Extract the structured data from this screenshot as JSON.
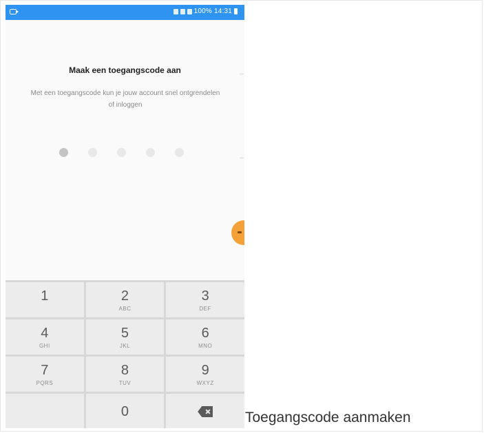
{
  "status_bar": {
    "right_text": "100% 14:31"
  },
  "screen": {
    "title": "Maak een toegangscode aan",
    "subtitle": "Met een toegangscode kun je jouw account snel ontgrendelen of inloggen",
    "pin_dots_total": 5,
    "pin_dots_filled": 1
  },
  "keypad": {
    "keys": [
      {
        "digit": "1",
        "letters": ""
      },
      {
        "digit": "2",
        "letters": "ABC"
      },
      {
        "digit": "3",
        "letters": "DEF"
      },
      {
        "digit": "4",
        "letters": "GHI"
      },
      {
        "digit": "5",
        "letters": "JKL"
      },
      {
        "digit": "6",
        "letters": "MNO"
      },
      {
        "digit": "7",
        "letters": "PQRS"
      },
      {
        "digit": "8",
        "letters": "TUV"
      },
      {
        "digit": "9",
        "letters": "WXYZ"
      },
      {
        "digit": "0",
        "letters": ""
      }
    ]
  },
  "caption": "Toegangscode aanmaken",
  "colors": {
    "status_bar": "#2f93f2",
    "fab": "#f5a13a",
    "keypad_bg": "#d7d7d7",
    "key_bg": "#ececec"
  },
  "icons": {
    "backspace": "backspace-icon",
    "status_left": "cast-icon",
    "fab": "next-arrow-icon"
  }
}
